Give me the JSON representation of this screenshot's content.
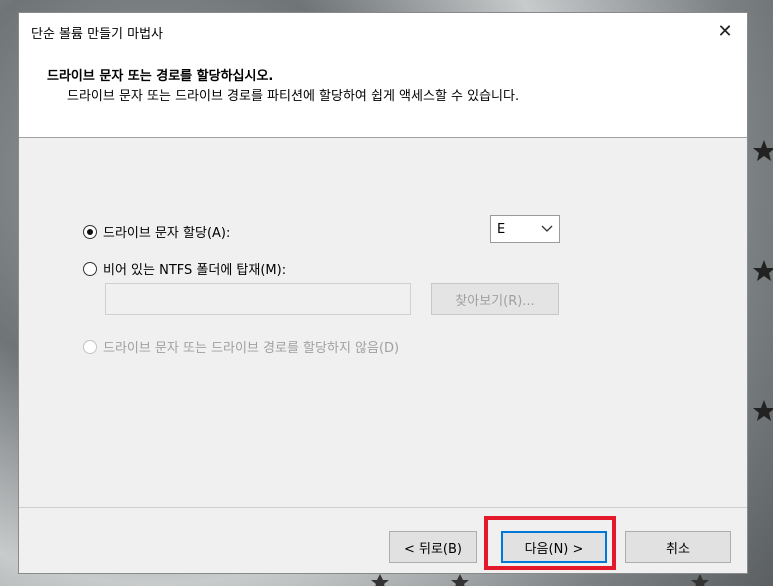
{
  "window": {
    "title": "단순 볼륨 만들기 마법사",
    "close_glyph": "✕"
  },
  "header": {
    "title": "드라이브 문자 또는 경로를 할당하십시오.",
    "subtitle": "드라이브 문자 또는 드라이브 경로를 파티션에 할당하여 쉽게 액세스할 수 있습니다."
  },
  "options": {
    "assign_letter_label": "드라이브 문자 할당(A):",
    "drive_letter_value": "E",
    "mount_folder_label": "비어 있는 NTFS 폴더에 탑재(M):",
    "folder_path_value": "",
    "browse_label": "찾아보기(R)...",
    "no_assign_label": "드라이브 문자 또는 드라이브 경로를 할당하지 않음(D)"
  },
  "buttons": {
    "back": "< 뒤로(B)",
    "next": "다음(N) >",
    "cancel": "취소"
  },
  "colors": {
    "highlight": "#e3192b",
    "focus": "#0078d7"
  }
}
